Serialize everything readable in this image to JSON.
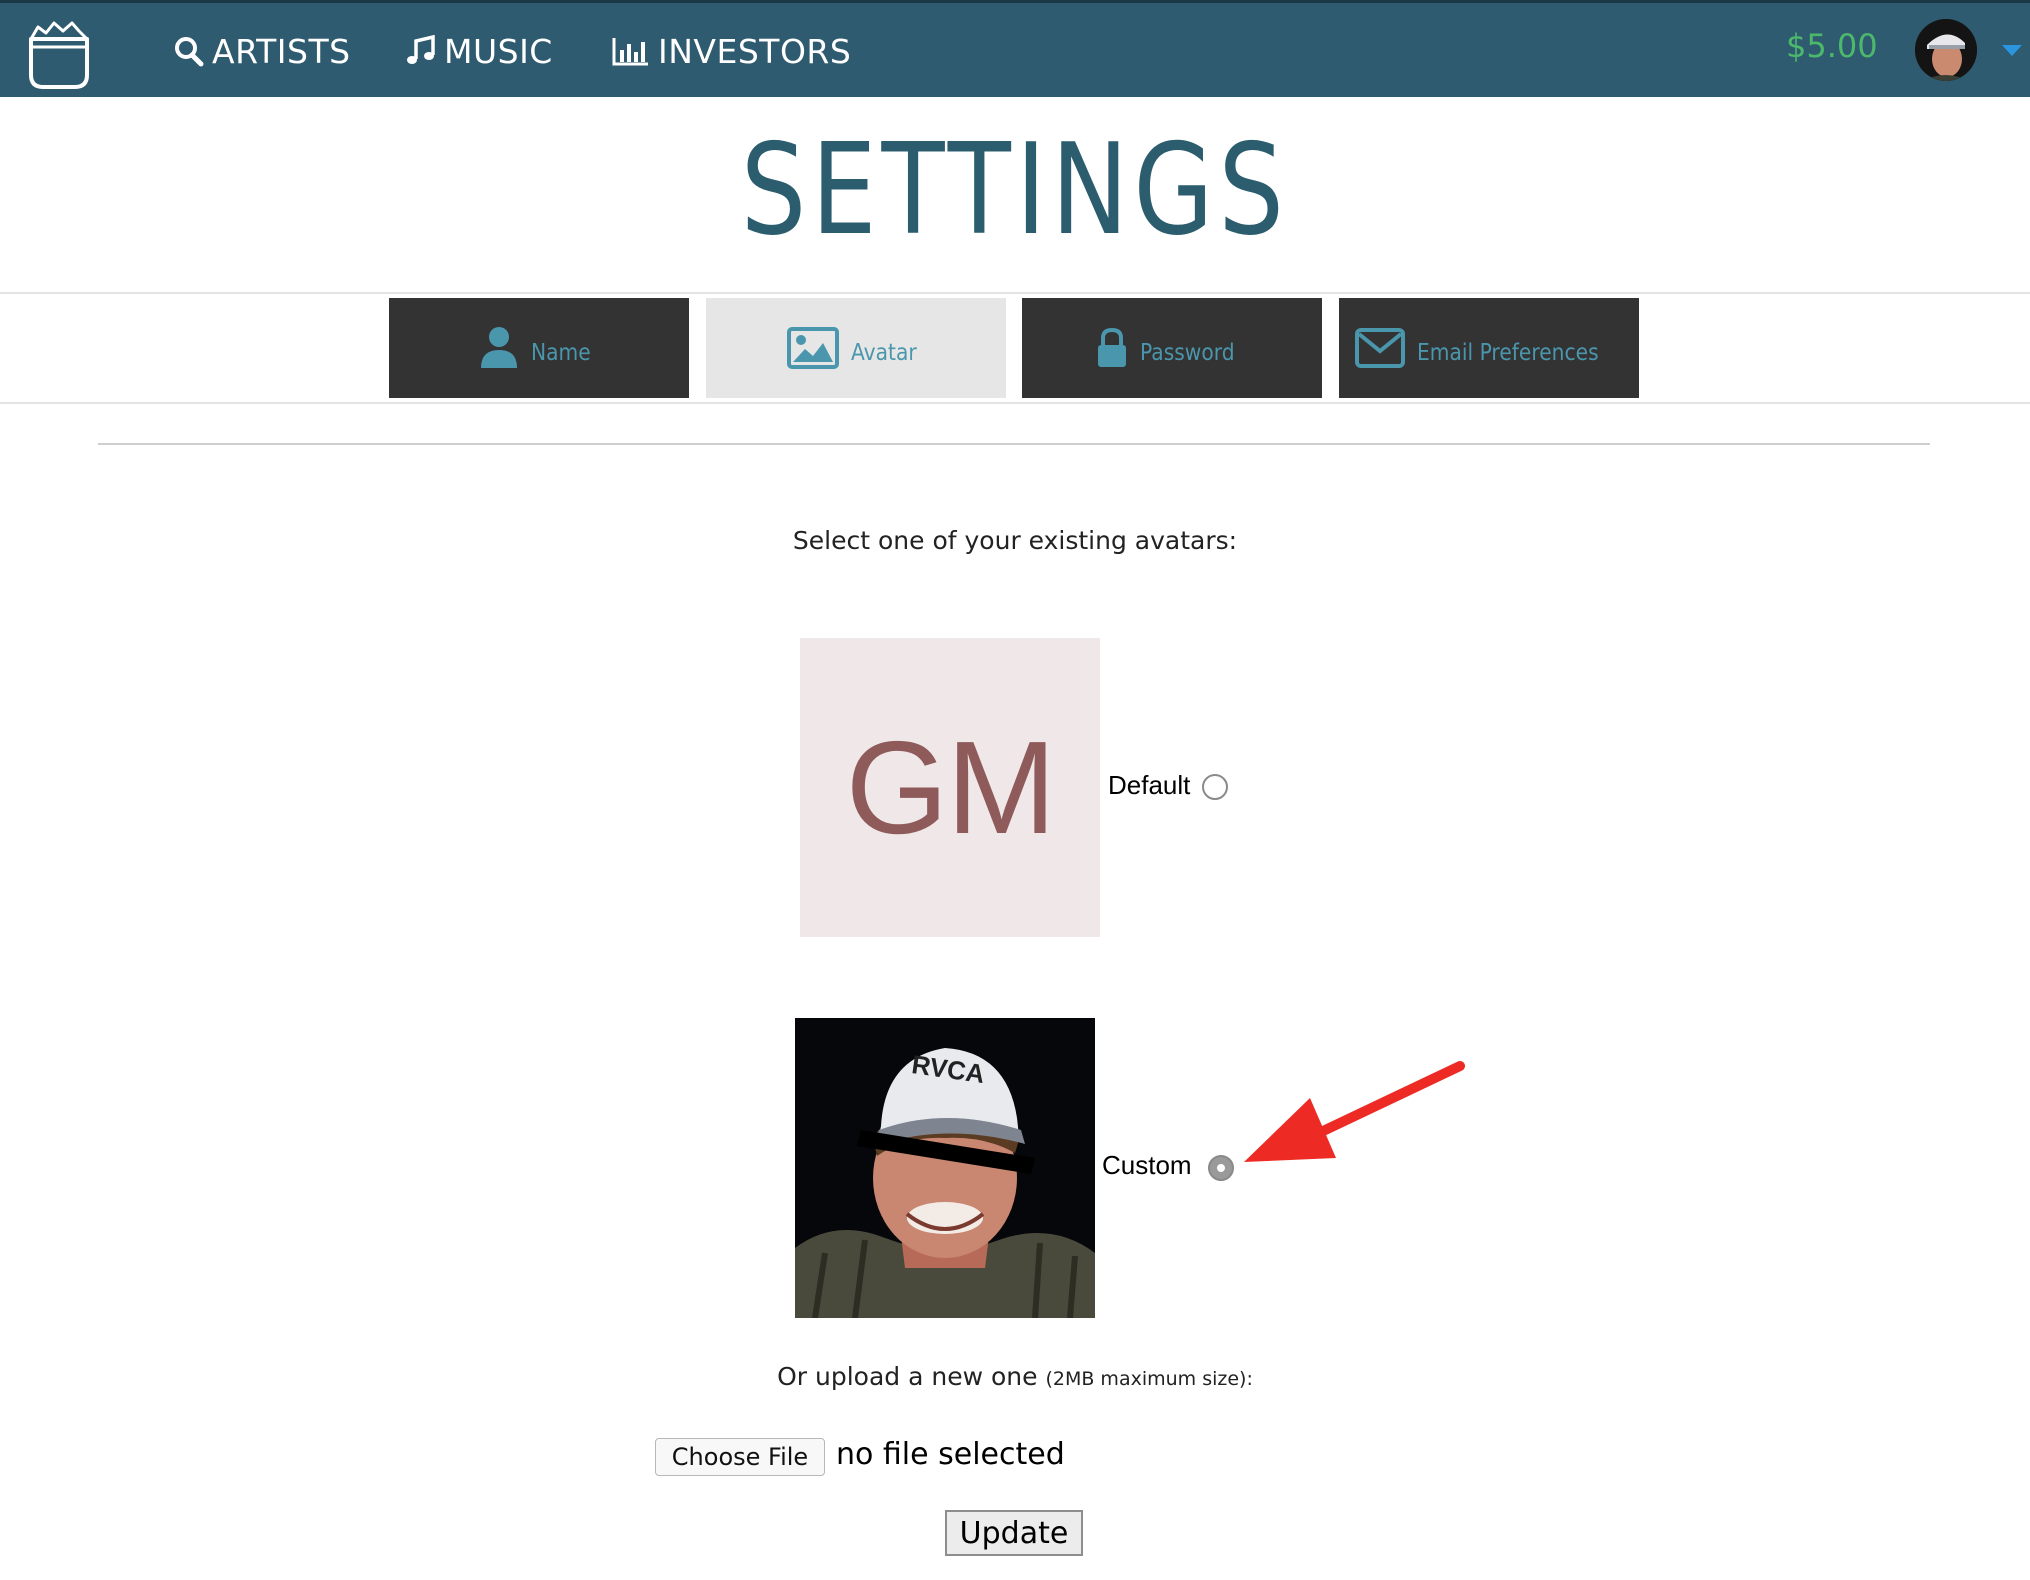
{
  "nav": {
    "items": [
      {
        "label": "ARTISTS",
        "icon": "search-icon"
      },
      {
        "label": "MUSIC",
        "icon": "music-note-icon"
      },
      {
        "label": "INVESTORS",
        "icon": "bar-chart-icon"
      }
    ],
    "balance": "$5.00",
    "logo_icon": "bucket-logo-icon"
  },
  "page": {
    "title": "SETTINGS"
  },
  "tabs": [
    {
      "label": "Name",
      "icon": "user-icon",
      "active": false
    },
    {
      "label": "Avatar",
      "icon": "image-icon",
      "active": true
    },
    {
      "label": "Password",
      "icon": "lock-icon",
      "active": false
    },
    {
      "label": "Email Preferences",
      "icon": "envelope-icon",
      "active": false
    }
  ],
  "avatar_section": {
    "prompt": "Select one of your existing avatars:",
    "default_initials": "GM",
    "default_label": "Default",
    "custom_label": "Custom",
    "selected": "Custom",
    "hat_text": "RVCA",
    "upload_text": "Or upload a new one",
    "upload_note": "(2MB maximum size):",
    "choose_file_label": "Choose File",
    "file_status": "no file selected",
    "update_label": "Update"
  },
  "colors": {
    "nav_bg": "#2e5b6f",
    "title": "#2c5d6e",
    "tab_dark": "#333333",
    "tab_active": "#e6e6e6",
    "tab_text": "#4a96ad",
    "balance": "#4cb86c",
    "initials": "#8f5a5a",
    "arrow": "#ee2a24",
    "caret": "#2b95e0"
  }
}
